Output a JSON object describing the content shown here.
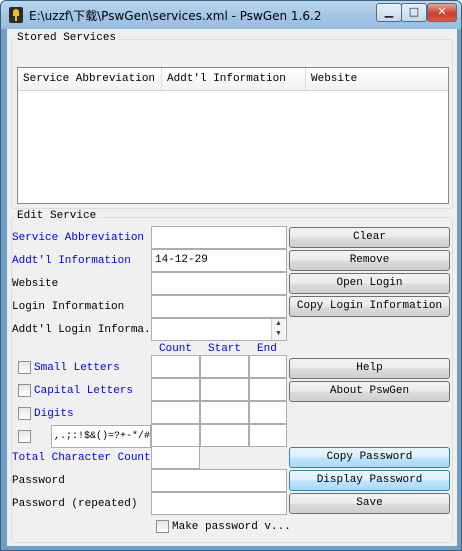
{
  "window": {
    "title": "E:\\uzzf\\下载\\PswGen\\services.xml - PswGen 1.6.2",
    "minimize_glyph": "▁",
    "maximize_glyph": "□",
    "close_glyph": "✕"
  },
  "stored_services": {
    "group_label": "Stored Services",
    "columns": [
      "Service Abbreviation",
      "Addt'l Information",
      "Website"
    ]
  },
  "edit_service": {
    "group_label": "Edit Service",
    "labels": {
      "service_abbreviation": "Service Abbreviation",
      "addtl_information": "Addt'l Information",
      "website": "Website",
      "login_information": "Login Information",
      "addtl_login_information": "Addt'l Login Informa...",
      "small_letters": "Small Letters",
      "capital_letters": "Capital Letters",
      "digits": "Digits",
      "total_character_count": "Total Character Count",
      "password": "Password",
      "password_repeated": "Password (repeated)",
      "make_password_visible": "Make password v..."
    },
    "values": {
      "service_abbreviation": "",
      "addtl_information": "14-12-29",
      "website": "",
      "login_information": "",
      "addtl_login_information": "",
      "special_characters": ",.;:!$&()=?+-*/#",
      "total_character_count": "",
      "password": "",
      "password_repeated": ""
    },
    "count_headers": {
      "count": "Count",
      "start": "Start",
      "end": "End"
    },
    "buttons": {
      "clear": "Clear",
      "remove": "Remove",
      "open_login": "Open Login",
      "copy_login_information": "Copy Login Information",
      "help": "Help",
      "about": "About PswGen",
      "copy_password": "Copy Password",
      "display_password": "Display Password",
      "save": "Save"
    },
    "spinner": {
      "up": "▲",
      "down": "▼"
    }
  }
}
